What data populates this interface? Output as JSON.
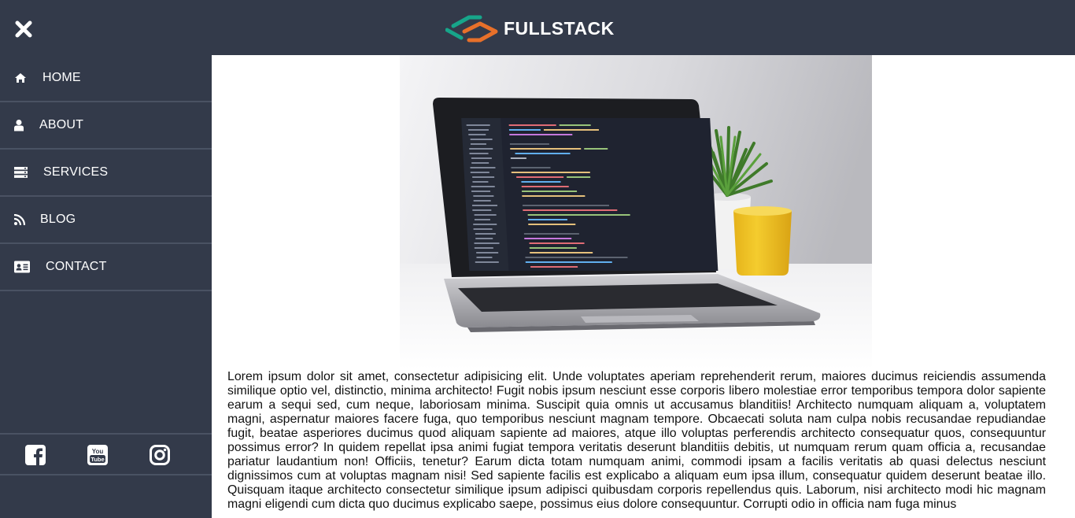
{
  "header": {
    "brand_name": "FULLSTACK",
    "close_icon": "close-icon",
    "accent_colors": [
      "#17a58a",
      "#e8702a"
    ]
  },
  "sidebar": {
    "background": "#333a4a",
    "items": [
      {
        "label": "HOME",
        "icon": "home-icon"
      },
      {
        "label": "ABOUT",
        "icon": "user-icon"
      },
      {
        "label": "SERVICES",
        "icon": "server-icon"
      },
      {
        "label": "BLOG",
        "icon": "rss-icon"
      },
      {
        "label": "CONTACT",
        "icon": "contact-card-icon"
      }
    ],
    "social": [
      {
        "name": "facebook",
        "icon": "facebook-icon"
      },
      {
        "name": "youtube",
        "icon": "youtube-icon"
      },
      {
        "name": "instagram",
        "icon": "instagram-icon"
      }
    ]
  },
  "main": {
    "hero_image": "laptop-on-desk-photo",
    "article_text": "Lorem ipsum dolor sit amet, consectetur adipisicing elit. Unde voluptates aperiam reprehenderit rerum, maiores ducimus reiciendis assumenda similique optio vel, distinctio, minima architecto! Fugit nobis ipsum nesciunt esse corporis libero molestiae error temporibus tempora dolor sapiente earum a sequi sed, cum neque, laboriosam minima. Suscipit quia omnis ut accusamus blanditiis! Architecto numquam aliquam a, voluptatem magni, aspernatur maiores facere fuga, quo temporibus nesciunt magnam tempore. Obcaecati soluta nam culpa nobis recusandae repudiandae fugit, beatae asperiores ducimus quod aliquam sapiente ad maiores, atque illo voluptas perferendis architecto consequatur quos, consequuntur possimus error? In quidem repellat ipsa animi fugiat tempora veritatis deserunt blanditiis debitis, ut numquam rerum quam officia a, recusandae pariatur laudantium non! Officiis, tenetur? Earum dicta totam numquam animi, commodi ipsam a facilis veritatis ab quasi delectus nesciunt dignissimos cum at voluptas magnam nisi! Sed sapiente facilis est explicabo a aliquam eum ipsa illum, consequatur quidem deserunt beatae illo. Quisquam itaque architecto consectetur similique ipsum adipisci quibusdam corporis repellendus quis. Laborum, nisi architecto modi hic magnam magni eligendi cum dicta quo ducimus explicabo saepe, possimus eius dolore consequuntur. Corrupti odio in officia nam fuga minus"
  }
}
